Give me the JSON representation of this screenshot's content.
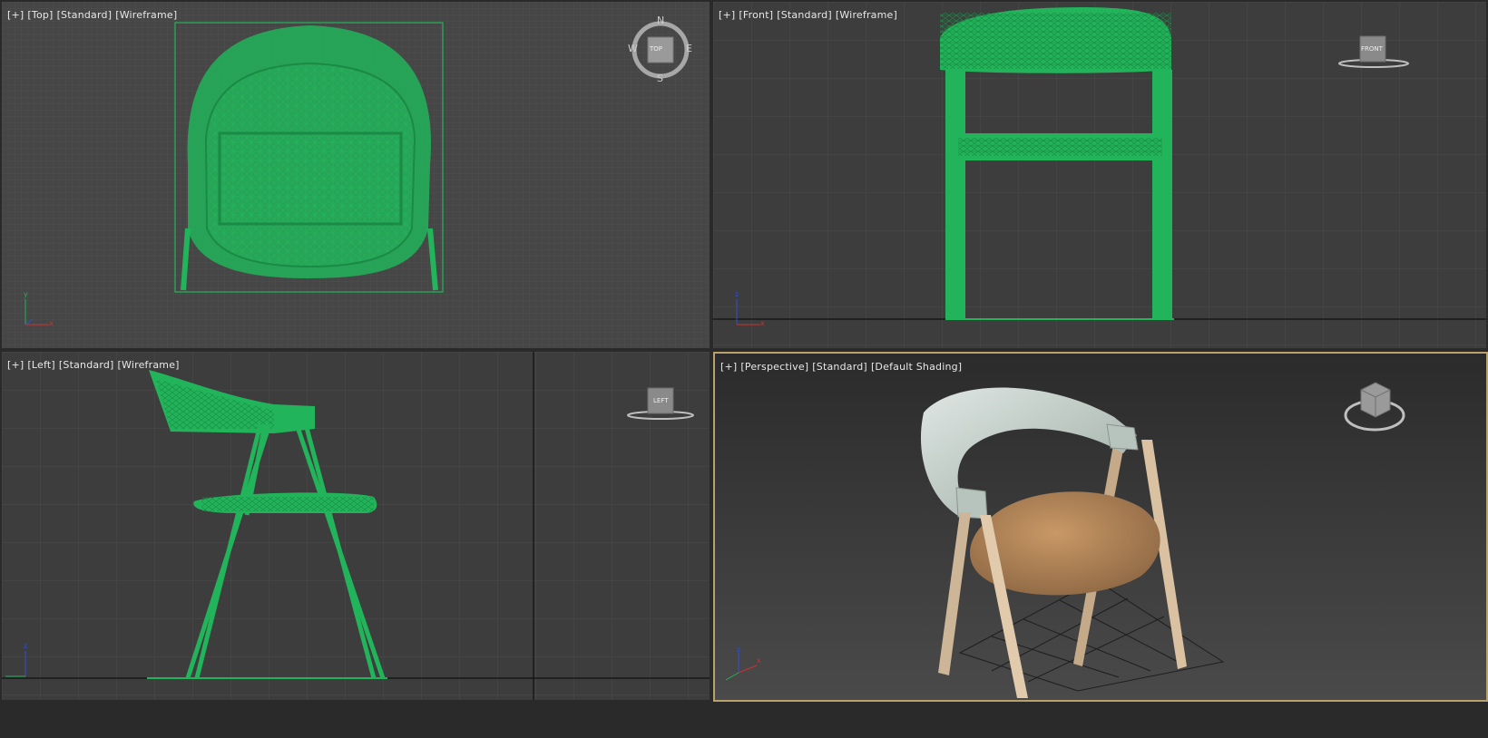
{
  "viewports": [
    {
      "id": "top",
      "labels": [
        "[+]",
        "[Top]",
        "[Standard]",
        "[Wireframe]"
      ],
      "navigator": "compass",
      "nav_text": "TOP",
      "compass": {
        "n": "N",
        "s": "S",
        "e": "E",
        "w": "W"
      }
    },
    {
      "id": "front",
      "labels": [
        "[+]",
        "[Front]",
        "[Standard]",
        "[Wireframe]"
      ],
      "navigator": "viewcube",
      "nav_text": "FRONT"
    },
    {
      "id": "left",
      "labels": [
        "[+]",
        "[Left]",
        "[Standard]",
        "[Wireframe]"
      ],
      "navigator": "viewcube",
      "nav_text": "LEFT"
    },
    {
      "id": "persp",
      "labels": [
        "[+]",
        "[Perspective]",
        "[Standard]",
        "[Default Shading]"
      ],
      "navigator": "viewcube3d",
      "nav_text": ""
    }
  ],
  "axis_labels": {
    "x": "x",
    "y": "y",
    "z": "z"
  },
  "colors": {
    "wire": "#22b45a",
    "grid_line": "#4c4c4c",
    "viewport_bg": "#3d3d3d",
    "active_border": "#b8a16a",
    "seat": "#b8875a",
    "shell": "#c9d4cf",
    "legs": "#d9c1a2"
  }
}
